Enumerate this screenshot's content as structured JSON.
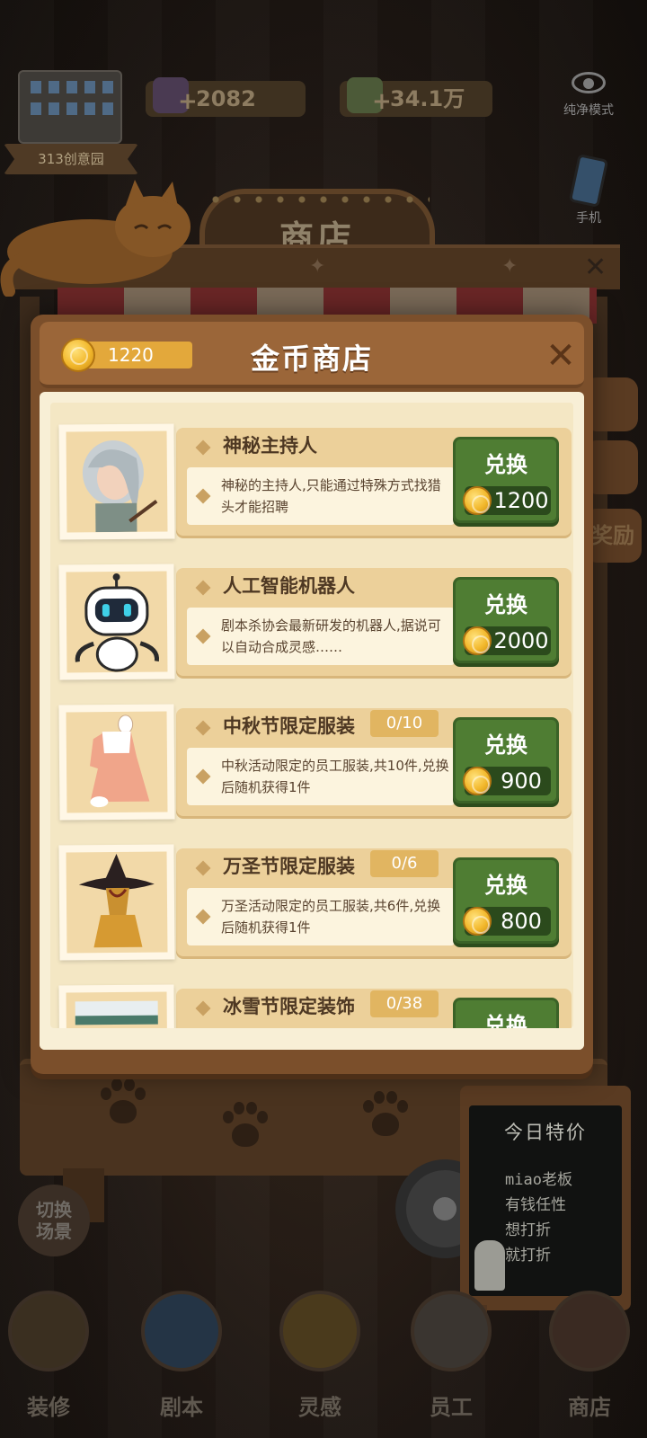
{
  "hud": {
    "location_tag": "313创意园",
    "gems": "2082",
    "cash": "34.1万",
    "pure_mode": "纯净模式",
    "phone": "手机"
  },
  "shop_sign": "商店",
  "side_tabs": [
    "奖励"
  ],
  "modal": {
    "balance": "1220",
    "title": "金币商店",
    "exchange_label": "兑换",
    "items": [
      {
        "name": "神秘主持人",
        "count": "",
        "desc": "神秘的主持人,只能通过特殊方式找猎头才能招聘",
        "price": "1200",
        "icon": "host-portrait-icon"
      },
      {
        "name": "人工智能机器人",
        "count": "",
        "desc": "剧本杀协会最新研发的机器人,据说可以自动合成灵感……",
        "price": "2000",
        "icon": "robot-icon"
      },
      {
        "name": "中秋节限定服装",
        "count": "0/10",
        "desc": "中秋活动限定的员工服装,共10件,兑换后随机获得1件",
        "price": "900",
        "icon": "mid-autumn-costume-icon"
      },
      {
        "name": "万圣节限定服装",
        "count": "0/6",
        "desc": "万圣活动限定的员工服装,共6件,兑换后随机获得1件",
        "price": "800",
        "icon": "halloween-costume-icon"
      },
      {
        "name": "冰雪节限定装饰",
        "count": "0/38",
        "desc": "",
        "price": "",
        "icon": "ice-festival-decoration-icon"
      }
    ]
  },
  "scene_switch": "切换\n场景",
  "board": {
    "title": "今日特价",
    "lines": [
      "miao老板",
      "有钱任性",
      "想打折",
      "就打折"
    ]
  },
  "bottom_nav": [
    "装修",
    "剧本",
    "灵感",
    "员工",
    "商店"
  ],
  "colors": {
    "exchange_green": "#4f7d33",
    "modal_brown": "#7b4f2b",
    "paper": "#f8efd6",
    "coin_gold": "#f2b82c"
  }
}
